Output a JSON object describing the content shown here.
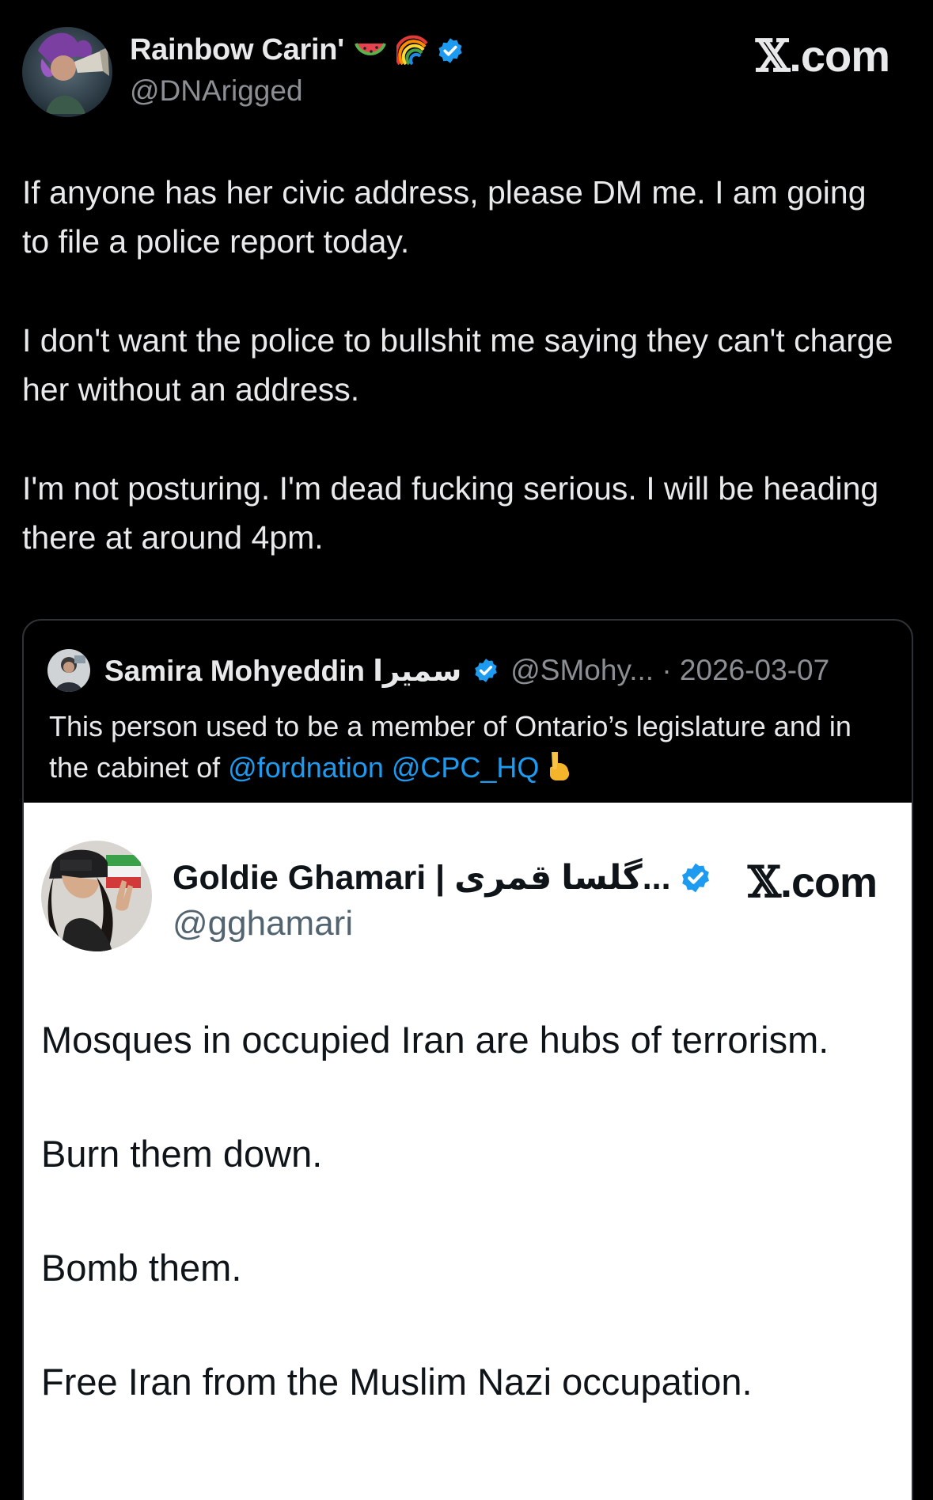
{
  "main_tweet": {
    "display_name": "Rainbow Carin'",
    "handle": "@DNArigged",
    "brand": ".com",
    "name_emojis": [
      "watermelon-icon",
      "rainbow-icon"
    ],
    "body": [
      "If anyone has her civic address, please DM me. I am going to file a police report today.",
      "I don't want the police to bullshit me saying they can't charge her without an address.",
      "I'm not posturing. I'm dead fucking serious. I will be heading there at around 4pm."
    ]
  },
  "quoted_tweet": {
    "display_name": "Samira Mohyeddin سمیرا",
    "meta": "@SMohy... · 2026-03-07",
    "text_prefix": "This person used to be a member of Ontario’s legislature and in the cabinet of ",
    "mention_1": "@fordnation",
    "mention_2": "@CPC_HQ",
    "trailing_emoji": "pointing-down-icon"
  },
  "embedded_screenshot": {
    "display_name": "Goldie Ghamari | گلسا قمری...",
    "handle": "@gghamari",
    "brand": ".com",
    "body": [
      "Mosques in occupied Iran are hubs of terrorism.",
      "Burn them down.",
      "Bomb them.",
      "Free Iran from the Muslim Nazi occupation."
    ]
  },
  "colors": {
    "background": "#000000",
    "text_primary": "#e7e9ea",
    "text_secondary": "#8b8f94",
    "link": "#1d9bf0",
    "verified": "#1d9bf0",
    "embed_background": "#ffffff"
  }
}
